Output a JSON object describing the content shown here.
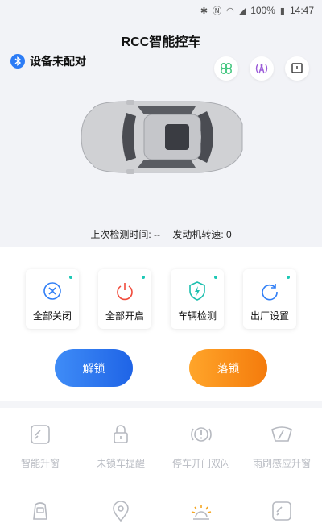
{
  "status_bar": {
    "battery": "100%",
    "time": "14:47"
  },
  "header": {
    "title": "RCC智能控车",
    "bluetooth_status": "设备未配对",
    "last_check_label": "上次检测时间: --",
    "engine_speed_label": "发动机转速: 0"
  },
  "controls": [
    {
      "label": "全部关闭",
      "icon": "close-circle-icon",
      "color": "#2f7ef6"
    },
    {
      "label": "全部开启",
      "icon": "power-icon",
      "color": "#f04a3a"
    },
    {
      "label": "车辆检测",
      "icon": "shield-bolt-icon",
      "color": "#1bbfae"
    },
    {
      "label": "出厂设置",
      "icon": "refresh-icon",
      "color": "#2f7ef6"
    }
  ],
  "actions": {
    "unlock": "解锁",
    "lock": "落锁"
  },
  "features": [
    {
      "label": "智能升窗",
      "icon": "window-icon"
    },
    {
      "label": "未锁车提醒",
      "icon": "lock-icon"
    },
    {
      "label": "停车开门双闪",
      "icon": "hazard-icon"
    },
    {
      "label": "雨刷感应升窗",
      "icon": "wiper-icon"
    },
    {
      "label": "",
      "icon": "car-door-icon"
    },
    {
      "label": "",
      "icon": "location-icon"
    },
    {
      "label": "",
      "icon": "light-icon"
    },
    {
      "label": "",
      "icon": "window-icon"
    }
  ],
  "colors": {
    "primary": "#2f7ef6",
    "accent_orange": "#f58a14",
    "teal": "#1cc8b5"
  }
}
